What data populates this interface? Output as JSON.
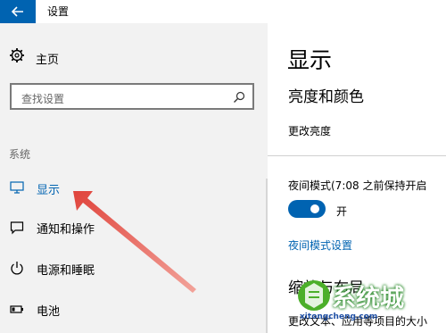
{
  "window": {
    "title": "设置",
    "back_icon": "back-arrow-icon",
    "accent": "#0063b1"
  },
  "sidebar": {
    "home_label": "主页",
    "search_placeholder": "查找设置",
    "section_header": "系统",
    "items": [
      {
        "label": "显示",
        "icon": "monitor-icon",
        "active": true
      },
      {
        "label": "通知和操作",
        "icon": "notification-icon",
        "active": false
      },
      {
        "label": "电源和睡眠",
        "icon": "power-icon",
        "active": false
      },
      {
        "label": "电池",
        "icon": "battery-icon",
        "active": false
      }
    ]
  },
  "main": {
    "page_title": "显示",
    "section1_heading": "亮度和颜色",
    "brightness_label": "更改亮度",
    "night_mode_label": "夜间模式(7:08 之前保持开启",
    "night_toggle_state": "开",
    "night_settings_link": "夜间模式设置",
    "section2_heading": "缩放与布局",
    "section2_desc": "更改文本、应用等项目的大小"
  },
  "watermark": {
    "text": "系统城",
    "url": "xitongcheng.com"
  },
  "annotation": {
    "arrow_color": "#e0443c"
  }
}
